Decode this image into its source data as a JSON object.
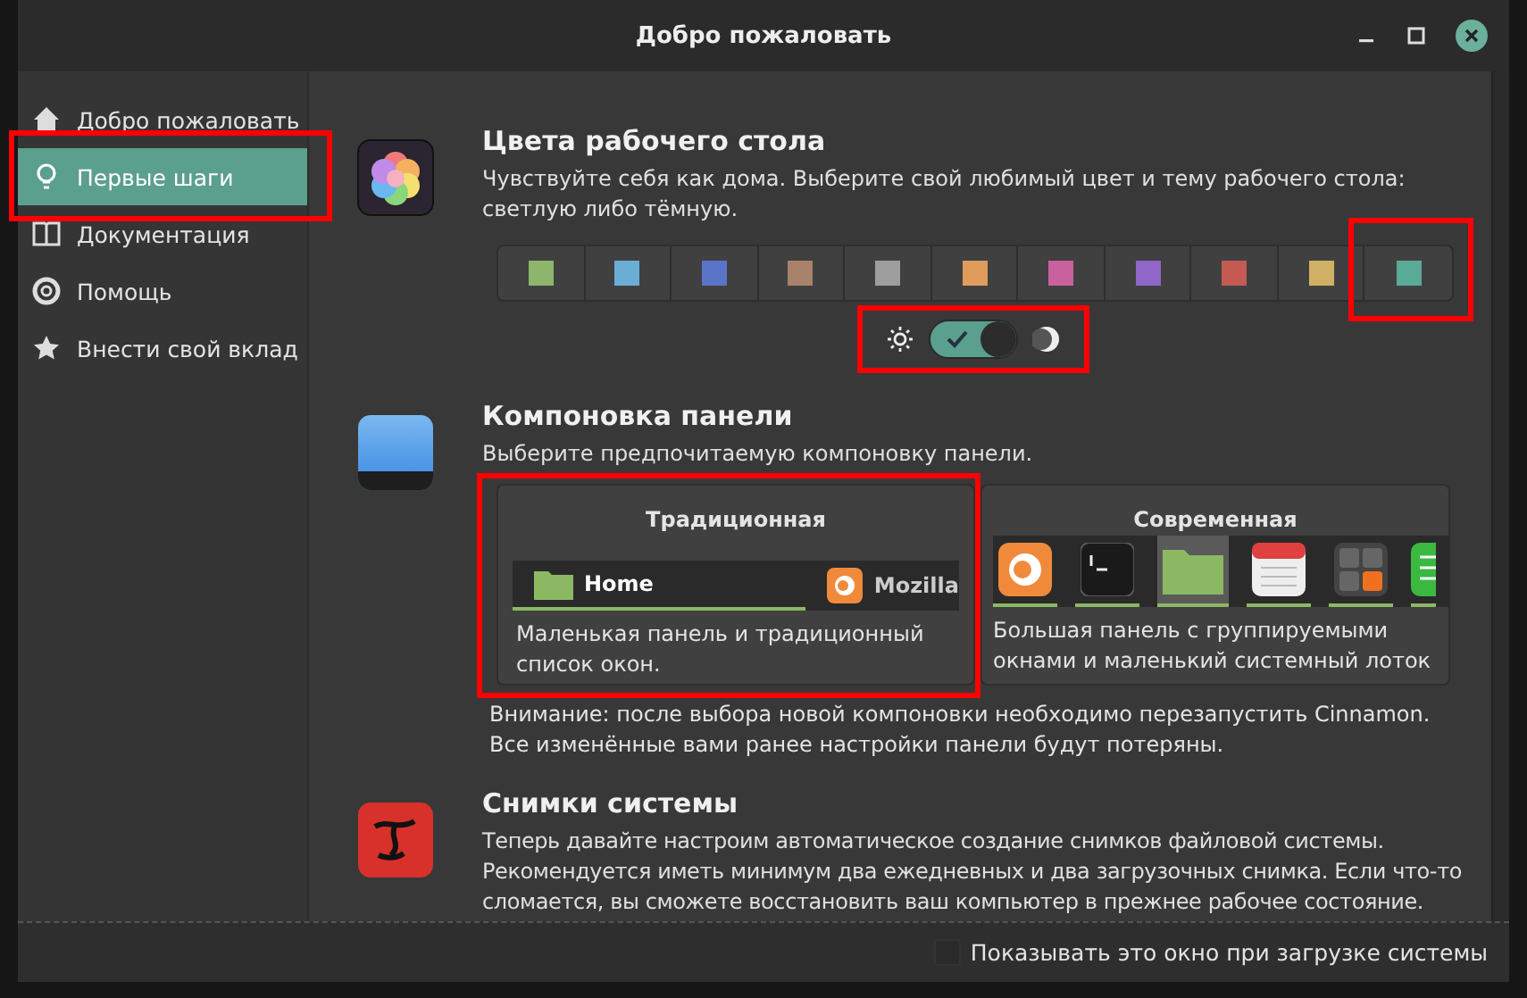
{
  "window": {
    "title": "Добро пожаловать"
  },
  "sidebar": {
    "items": [
      {
        "label": "Добро пожаловать",
        "selected": false,
        "highlighted": false
      },
      {
        "label": "Первые шаги",
        "selected": true,
        "highlighted": true
      },
      {
        "label": "Документация",
        "selected": false,
        "highlighted": false
      },
      {
        "label": "Помощь",
        "selected": false,
        "highlighted": false
      },
      {
        "label": "Внести свой вклад",
        "selected": false,
        "highlighted": false
      }
    ]
  },
  "sections": [
    {
      "kind": "colors",
      "title": "Цвета рабочего стола",
      "description": "Чувствуйте себя как дома. Выберите свой любимый цвет и тему рабочего стола: светлую либо тёмную.",
      "swatches": [
        {
          "color": "#8db56c",
          "highlighted": false
        },
        {
          "color": "#6aaed6",
          "highlighted": false
        },
        {
          "color": "#5a74c8",
          "highlighted": false
        },
        {
          "color": "#a8826a",
          "highlighted": false
        },
        {
          "color": "#9e9e9e",
          "highlighted": false
        },
        {
          "color": "#e09c5a",
          "highlighted": false
        },
        {
          "color": "#c8619e",
          "highlighted": false
        },
        {
          "color": "#9066c8",
          "highlighted": false
        },
        {
          "color": "#c45a52",
          "highlighted": false
        },
        {
          "color": "#d0b064",
          "highlighted": false
        },
        {
          "color": "#5aaa98",
          "highlighted": true
        }
      ],
      "theme_toggle": {
        "on": true,
        "highlighted": true
      }
    },
    {
      "kind": "layout",
      "title": "Компоновка панели",
      "description": "Выберите предпочитаемую компоновку панели.",
      "options": [
        {
          "kind": "traditional",
          "title": "Традиционная",
          "description": "Маленькая панель и традиционный список окон.",
          "window_labels": [
            "Home",
            "Mozilla"
          ],
          "highlighted": true
        },
        {
          "kind": "modern",
          "title": "Современная",
          "description": "Большая панель с группируемыми окнами и маленький системный лоток",
          "highlighted": false
        }
      ],
      "warning": "Внимание: после выбора новой компоновки необходимо перезапустить Cinnamon. Все изменённые вами ранее настройки панели будут потеряны."
    },
    {
      "kind": "snapshots",
      "title": "Снимки системы",
      "description": "Теперь давайте настроим автоматическое создание снимков файловой системы. Рекомендуется иметь минимум два ежедневных и два загрузочных снимка. Если что-то сломается, вы сможете восстановить ваш компьютер в прежнее рабочее состояние."
    }
  ],
  "footer": {
    "checkbox": {
      "label": "Показывать это окно при загрузке системы",
      "checked": false
    }
  }
}
